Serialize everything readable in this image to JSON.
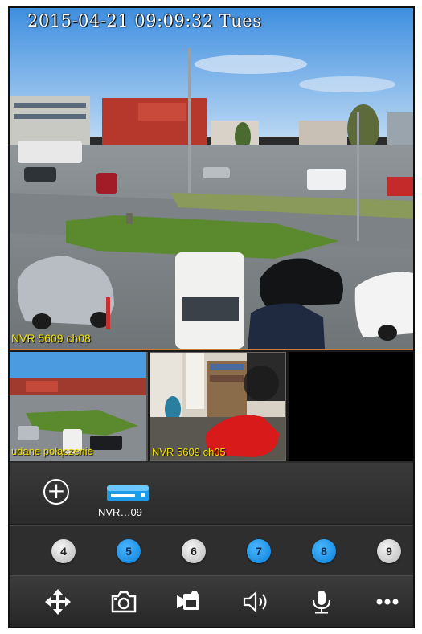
{
  "main_view": {
    "timestamp": "2015-04-21  09:09:32  Tues",
    "channel_label": "NVR 5609 ch08"
  },
  "thumbnails": [
    {
      "label": "udane połączenie"
    },
    {
      "label": "NVR 5609 ch05"
    },
    {
      "label": ""
    }
  ],
  "device": {
    "add_icon": "plus-circle-icon",
    "name": "NVR…09"
  },
  "channels": [
    {
      "label": "4",
      "active": false
    },
    {
      "label": "5",
      "active": true
    },
    {
      "label": "6",
      "active": false
    },
    {
      "label": "7",
      "active": true
    },
    {
      "label": "8",
      "active": true
    },
    {
      "label": "9",
      "active": false
    }
  ],
  "toolbar": {
    "icons": [
      "ptz-move-icon",
      "snapshot-camera-icon",
      "record-video-icon",
      "speaker-icon",
      "microphone-icon",
      "more-icon"
    ]
  },
  "colors": {
    "osd_text": "#f2e200",
    "channel_active": "#0a7fd8",
    "channel_inactive": "#d9d9d9",
    "selection_border": "#d07a3a"
  }
}
